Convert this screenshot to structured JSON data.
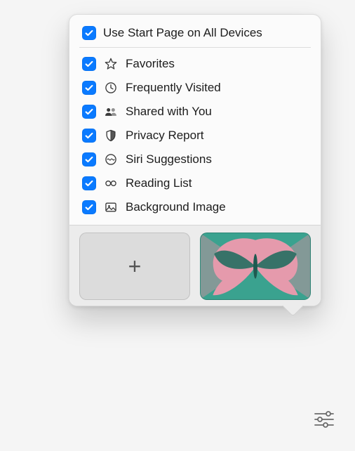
{
  "colors": {
    "accent": "#0a7aff"
  },
  "top": {
    "label": "Use Start Page on All Devices",
    "checked": true
  },
  "options": [
    {
      "id": "favorites",
      "label": "Favorites",
      "icon": "star-icon",
      "checked": true
    },
    {
      "id": "frequently-visited",
      "label": "Frequently Visited",
      "icon": "clock-icon",
      "checked": true
    },
    {
      "id": "shared-with-you",
      "label": "Shared with You",
      "icon": "people-icon",
      "checked": true
    },
    {
      "id": "privacy-report",
      "label": "Privacy Report",
      "icon": "shield-icon",
      "checked": true
    },
    {
      "id": "siri-suggestions",
      "label": "Siri Suggestions",
      "icon": "siri-icon",
      "checked": true
    },
    {
      "id": "reading-list",
      "label": "Reading List",
      "icon": "glasses-icon",
      "checked": true
    },
    {
      "id": "background-image",
      "label": "Background Image",
      "icon": "image-icon",
      "checked": true
    }
  ],
  "backgroundTiles": {
    "add": {
      "symbol": "+"
    },
    "preset": {
      "name": "butterfly"
    }
  }
}
